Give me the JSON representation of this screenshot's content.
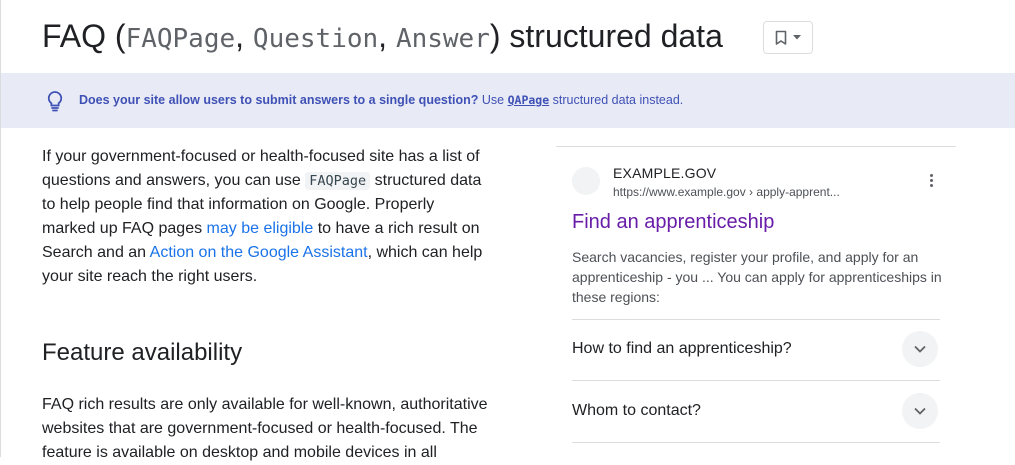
{
  "header": {
    "title_prefix": "FAQ (",
    "title_code1": "FAQPage",
    "title_sep1": ", ",
    "title_code2": "Question",
    "title_sep2": ", ",
    "title_code3": "Answer",
    "title_suffix": ") structured data",
    "bookmark_icon": "bookmark-icon",
    "dropdown_icon": "caret-down-icon"
  },
  "banner": {
    "icon": "lightbulb-icon",
    "question": "Does your site allow users to submit answers to a single question?",
    "text_before": " Use ",
    "link": "QAPage",
    "text_after": " structured data instead."
  },
  "intro": {
    "t1": "If your government-focused or health-focused site has a list of questions and answers, you can use ",
    "code": "FAQPage",
    "t2": " structured data to help people find that information on Google. Properly marked up FAQ pages ",
    "link1": "may be eligible",
    "t3": " to have a rich result on Search and an ",
    "link2": "Action on the Google Assistant",
    "t4": ", which can help your site reach the right users."
  },
  "feature": {
    "heading": "Feature availability",
    "text": "FAQ rich results are only available for well-known, authoritative websites that are government-focused or health-focused. The feature is available on desktop and mobile devices in all"
  },
  "result_card": {
    "site_name": "EXAMPLE.GOV",
    "url": "https://www.example.gov › apply-apprent...",
    "title": "Find an apprenticeship",
    "snippet": "Search vacancies, register your profile, and apply for an apprenticeship - you ... You can apply for apprenticeships in these regions:",
    "faq": [
      {
        "question": "How to find an apprenticeship?"
      },
      {
        "question": "Whom to contact?"
      }
    ],
    "more_icon": "more-vert-icon",
    "expand_icon": "chevron-down-icon"
  },
  "colors": {
    "banner_bg": "#e8eaf6",
    "banner_text": "#3f51b5",
    "link": "#1a73e8",
    "result_title": "#681da8"
  }
}
